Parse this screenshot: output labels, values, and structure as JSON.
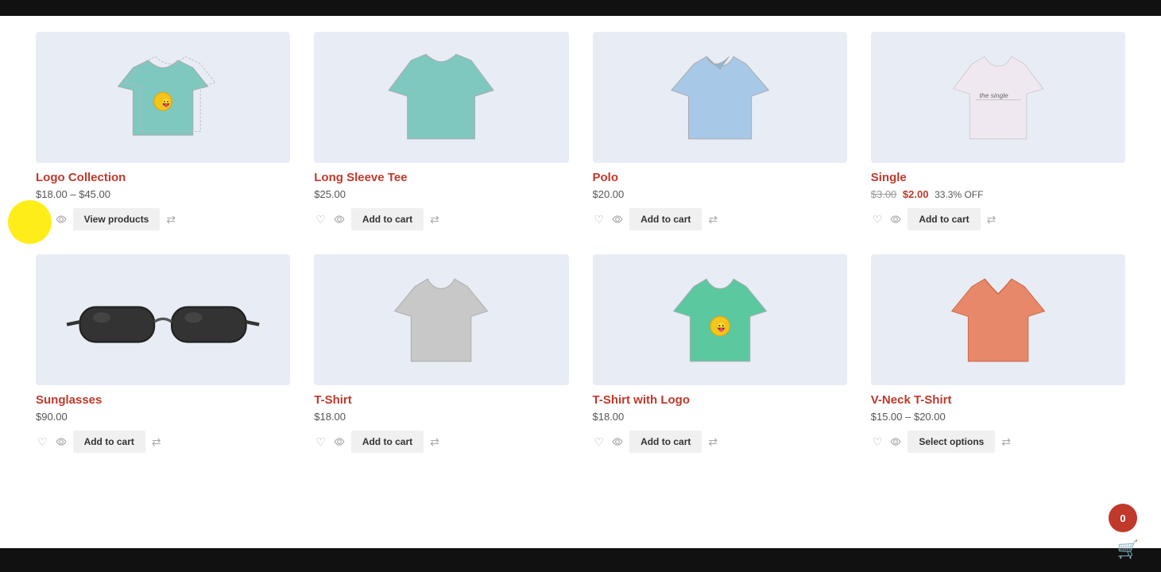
{
  "topBar": {
    "visible": true
  },
  "cartBubble": {
    "count": "0"
  },
  "row1": {
    "products": [
      {
        "id": "logo-collection",
        "name": "Logo Collection",
        "price": "$18.00 – $45.00",
        "priceType": "range",
        "actionLabel": "View products",
        "imageType": "logo-tshirt"
      },
      {
        "id": "long-sleeve-tee",
        "name": "Long Sleeve Tee",
        "price": "$25.00",
        "priceType": "single",
        "actionLabel": "Add to cart",
        "imageType": "long-sleeve"
      },
      {
        "id": "polo",
        "name": "Polo",
        "price": "$20.00",
        "priceType": "single",
        "actionLabel": "Add to cart",
        "imageType": "polo"
      },
      {
        "id": "single",
        "name": "Single",
        "priceOriginal": "$3.00",
        "priceSale": "$2.00",
        "priceOff": "33.3% OFF",
        "priceType": "sale",
        "actionLabel": "Add to cart",
        "imageType": "single-tshirt"
      }
    ]
  },
  "row2": {
    "products": [
      {
        "id": "sunglasses",
        "name": "Sunglasses",
        "price": "$90.00",
        "priceType": "single",
        "actionLabel": "Add to cart",
        "imageType": "sunglasses"
      },
      {
        "id": "tshirt",
        "name": "T-Shirt",
        "price": "$18.00",
        "priceType": "single",
        "actionLabel": "Add to cart",
        "imageType": "plain-tshirt"
      },
      {
        "id": "tshirt-logo",
        "name": "T-Shirt with Logo",
        "price": "$18.00",
        "priceType": "single",
        "actionLabel": "Add to cart",
        "imageType": "logo-tshirt-green"
      },
      {
        "id": "vneck",
        "name": "V-Neck T-Shirt",
        "price": "$15.00 – $20.00",
        "priceType": "range",
        "actionLabel": "Select options",
        "imageType": "vneck"
      }
    ]
  },
  "icons": {
    "heart": "♡",
    "eye": "👁",
    "compare": "⇄",
    "cart": "🛒"
  }
}
